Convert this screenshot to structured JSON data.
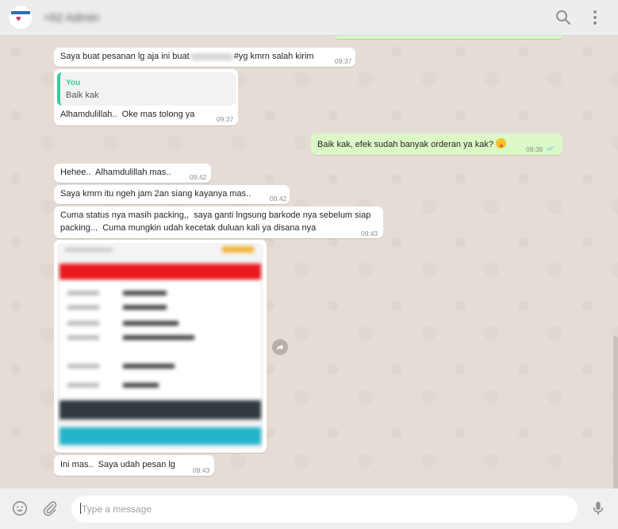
{
  "header": {
    "contact_name": "+62 Admin",
    "search_icon": "search-icon",
    "menu_icon": "kebab-menu-icon"
  },
  "messages": [
    {
      "id": "m1",
      "direction": "in",
      "text_before": "Saya buat pesanan lg aja ini buat",
      "text_after": "#yg kmrn salah kirim",
      "time": "09:37"
    },
    {
      "id": "m2",
      "direction": "in",
      "quote_author": "You",
      "quote_text": "Baik kak",
      "text": "Alhamdulillah..  Oke mas tolong ya",
      "time": "09:37"
    },
    {
      "id": "m3",
      "direction": "out",
      "text": "Baik kak, efek sudah banyak orderan ya kak?",
      "time": "09:38",
      "status": "read"
    },
    {
      "id": "m4",
      "direction": "in",
      "text": "Hehee..  Alhamdulillah mas..",
      "time": "09:42"
    },
    {
      "id": "m5",
      "direction": "in",
      "text": "Saya kmrn itu ngeh jam 2an siang kayanya mas..",
      "time": "09:42"
    },
    {
      "id": "m6",
      "direction": "in",
      "text_line1": "Cuma status nya masih packing,,  saya ganti lngsung barkode nya sebelum siap",
      "text_line2": "packing...  Cuma mungkin udah kecetak duluan kali ya disana nya",
      "time": "09:43"
    },
    {
      "id": "m7",
      "direction": "in",
      "type": "image"
    },
    {
      "id": "m8",
      "direction": "in",
      "text": "Ini mas..  Saya udah pesan lg",
      "time": "09:43"
    }
  ],
  "composer": {
    "placeholder": "Type a message",
    "emoji_icon": "emoji-icon",
    "attach_icon": "paperclip-icon",
    "mic_icon": "microphone-icon"
  },
  "colors": {
    "incoming_bubble": "#ffffff",
    "outgoing_bubble": "#dcf8c6",
    "chat_background": "#e5ddd5",
    "read_ticks": "#4fc3f7",
    "quote_accent": "#35cd96"
  }
}
